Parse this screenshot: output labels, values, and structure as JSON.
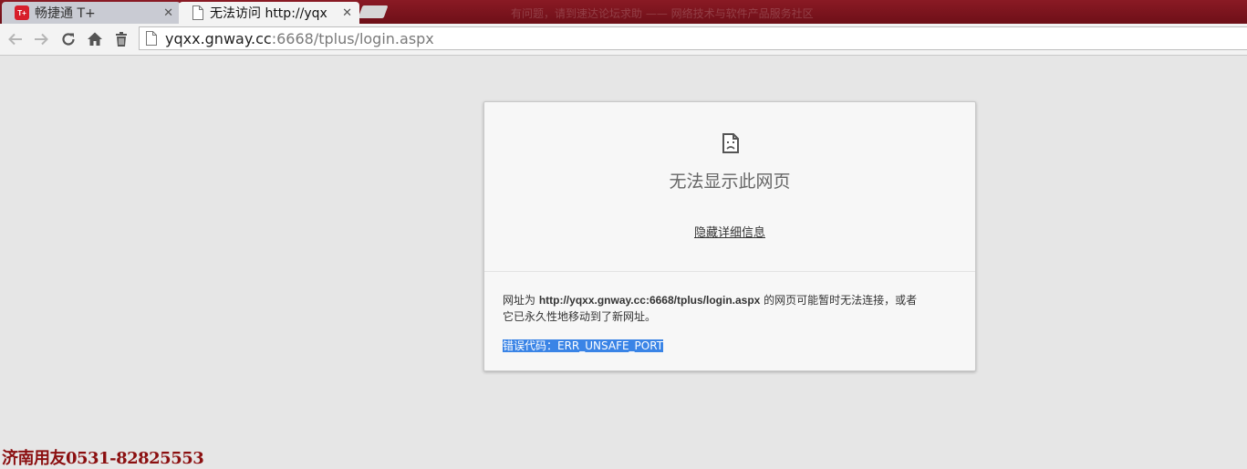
{
  "window": {
    "title_text": "有问题，请到速达论坛求助 —— 网络技术与软件产品服务社区"
  },
  "tabs": [
    {
      "title": "畅捷通 T+",
      "favicon": "tplus-logo-icon",
      "favicon_text": "T+",
      "active": false
    },
    {
      "title": "无法访问 http://yqx",
      "favicon": "page-icon",
      "active": true
    }
  ],
  "address_bar": {
    "host": "yqxx.gnway.cc",
    "path": ":6668/tplus/login.aspx"
  },
  "error_page": {
    "icon": "sad-file-icon",
    "title": "无法显示此网页",
    "details_link": "隐藏详细信息",
    "message_prefix": "网址为 ",
    "message_url": "http://yqxx.gnway.cc:6668/tplus/login.aspx",
    "message_line1_suffix": " 的网页可能暂时无法连接，或者",
    "message_line2": "它已永久性地移动到了新网址。",
    "error_code": "错误代码：ERR_UNSAFE_PORT"
  },
  "watermark": "济南用友0531-82825553",
  "colors": {
    "tabstrip": "#7a1520",
    "selection": "#3a84e6",
    "watermark": "#8b0f10"
  }
}
